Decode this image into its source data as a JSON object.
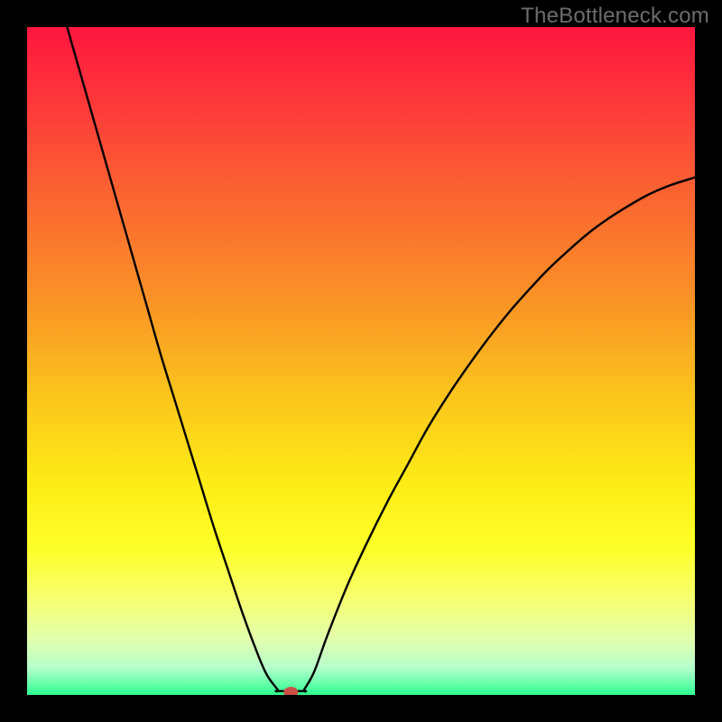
{
  "watermark": "TheBottleneck.com",
  "chart_data": {
    "type": "line",
    "title": "",
    "xlabel": "",
    "ylabel": "",
    "xlim": [
      0,
      100
    ],
    "ylim": [
      0,
      100
    ],
    "grid": false,
    "legend": false,
    "description": "Bottleneck curve over a red-to-green vertical gradient. Two curve branches descend into a narrow valley touching y≈0 at x≈39, with a small red dot at the minimum and a short flat green segment along the bottom.",
    "series": [
      {
        "name": "left-branch",
        "x": [
          6,
          8,
          10,
          12,
          14,
          16,
          18,
          20,
          22,
          24,
          26,
          28,
          30,
          32,
          34,
          35.8,
          37.5
        ],
        "y": [
          100,
          93,
          86,
          79,
          72,
          65,
          58,
          51,
          44.5,
          38,
          31.5,
          25,
          19,
          13,
          7.5,
          3.2,
          0.8
        ]
      },
      {
        "name": "valley-floor",
        "x": [
          37.5,
          41.5
        ],
        "y": [
          0.6,
          0.6
        ]
      },
      {
        "name": "right-branch",
        "x": [
          41.5,
          43,
          45,
          48,
          51,
          54,
          57,
          60,
          63,
          66,
          69,
          72,
          75,
          78,
          81,
          84,
          87,
          90,
          93,
          96,
          100
        ],
        "y": [
          0.8,
          3.5,
          9,
          16.5,
          23,
          29,
          34.5,
          40,
          44.8,
          49.2,
          53.3,
          57.1,
          60.5,
          63.7,
          66.5,
          69.1,
          71.3,
          73.2,
          74.9,
          76.2,
          77.5
        ]
      }
    ],
    "marker": {
      "x": 39.5,
      "y": 0.4,
      "color": "#c94f44"
    },
    "gradient_stops": [
      {
        "pct": 0,
        "color": "#fe163e"
      },
      {
        "pct": 12,
        "color": "#fd3a3a"
      },
      {
        "pct": 25,
        "color": "#fb6431"
      },
      {
        "pct": 40,
        "color": "#fa9027"
      },
      {
        "pct": 55,
        "color": "#fbc41c"
      },
      {
        "pct": 68,
        "color": "#fdeb16"
      },
      {
        "pct": 78,
        "color": "#feff28"
      },
      {
        "pct": 86,
        "color": "#f6ff74"
      },
      {
        "pct": 92,
        "color": "#e0ffb0"
      },
      {
        "pct": 96,
        "color": "#b4ffcd"
      },
      {
        "pct": 100,
        "color": "#2cff8f"
      }
    ]
  }
}
